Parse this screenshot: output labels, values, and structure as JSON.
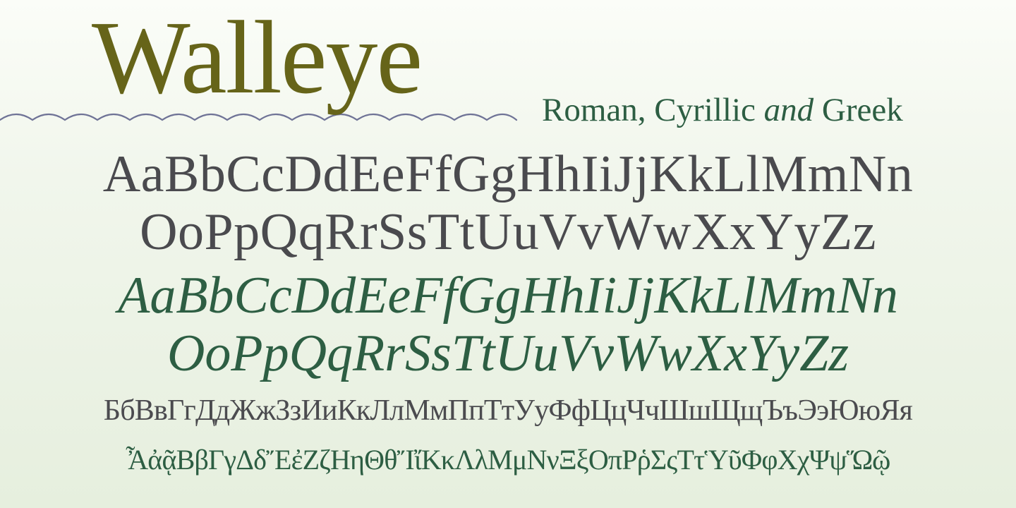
{
  "colors": {
    "title": "#666419",
    "subtitle": "#2d5e43",
    "roman": "#4a4a4e",
    "italic": "#2d5e43",
    "cyrillic": "#4b4b4f",
    "greek": "#2d5e43",
    "wave": "#6f7396"
  },
  "title": "Walleye",
  "subtitle": {
    "part1": "Roman, Cyrillic ",
    "conjunction": "and",
    "part2": " Greek"
  },
  "roman": {
    "line1": "AaBbCcDdEeFfGgHhIiJjKkLlMmNn",
    "line2": "OoPpQqRrSsTtUuVvWwXxYyZz"
  },
  "italic": {
    "line1": "AaBbCcDdEeFfGgHhIiJjKkLlMmNn",
    "line2": "OoPpQqRrSsTtUuVvWwXxYyZz"
  },
  "cyrillic": "БбВвГгДдЖжЗзИиКкЛлМмПпТтУуФфЦцЧчШшЩщЪъЭэЮюЯя",
  "greek": "ἎἀᾷΒβΓγΔδἜἐΖζΗηΘθἼἴΚκΛλΜμΝνΞξΟπΡῥΣςΤτὙῦΦφΧχΨψὭῷ"
}
